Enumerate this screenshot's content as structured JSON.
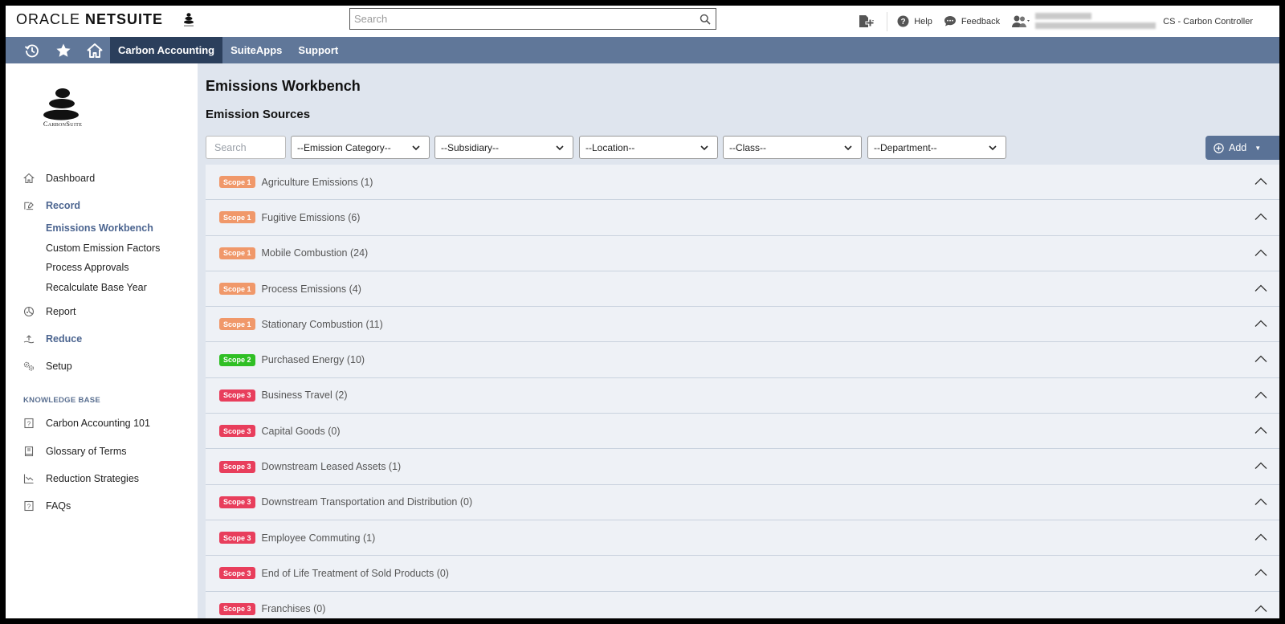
{
  "header": {
    "brand_regular": "ORACLE ",
    "brand_bold": "NETSUITE",
    "search_placeholder": "Search",
    "help_label": "Help",
    "feedback_label": "Feedback",
    "role_label": "CS - Carbon Controller"
  },
  "navbar": {
    "tabs": [
      {
        "label": "Carbon Accounting",
        "active": true
      },
      {
        "label": "SuiteApps",
        "active": false
      },
      {
        "label": "Support",
        "active": false
      }
    ]
  },
  "sidebar": {
    "brand_name": "CarbonSuite",
    "items": {
      "dashboard": "Dashboard",
      "record": "Record",
      "report": "Report",
      "reduce": "Reduce",
      "setup": "Setup"
    },
    "record_sub": [
      "Emissions Workbench",
      "Custom Emission Factors",
      "Process Approvals",
      "Recalculate Base Year"
    ],
    "knowledge_base_heading": "KNOWLEDGE BASE",
    "knowledge_base": [
      "Carbon Accounting 101",
      "Glossary of Terms",
      "Reduction Strategies",
      "FAQs"
    ]
  },
  "main": {
    "page_title": "Emissions Workbench",
    "section_title": "Emission Sources",
    "search_placeholder": "Search",
    "filters": [
      "--Emission Category--",
      "--Subsidiary--",
      "--Location--",
      "--Class--",
      "--Department--"
    ],
    "add_label": "Add",
    "scope_colors": {
      "Scope 1": "#f0986a",
      "Scope 2": "#2fbf24",
      "Scope 3": "#e83e5c"
    },
    "sources": [
      {
        "scope": "Scope 1",
        "label": "Agriculture Emissions (1)"
      },
      {
        "scope": "Scope 1",
        "label": "Fugitive Emissions (6)"
      },
      {
        "scope": "Scope 1",
        "label": "Mobile Combustion (24)"
      },
      {
        "scope": "Scope 1",
        "label": "Process Emissions (4)"
      },
      {
        "scope": "Scope 1",
        "label": "Stationary Combustion (11)"
      },
      {
        "scope": "Scope 2",
        "label": "Purchased Energy (10)"
      },
      {
        "scope": "Scope 3",
        "label": "Business Travel (2)"
      },
      {
        "scope": "Scope 3",
        "label": "Capital Goods (0)"
      },
      {
        "scope": "Scope 3",
        "label": "Downstream Leased Assets (1)"
      },
      {
        "scope": "Scope 3",
        "label": "Downstream Transportation and Distribution (0)"
      },
      {
        "scope": "Scope 3",
        "label": "Employee Commuting (1)"
      },
      {
        "scope": "Scope 3",
        "label": "End of Life Treatment of Sold Products (0)"
      },
      {
        "scope": "Scope 3",
        "label": "Franchises (0)"
      }
    ]
  }
}
